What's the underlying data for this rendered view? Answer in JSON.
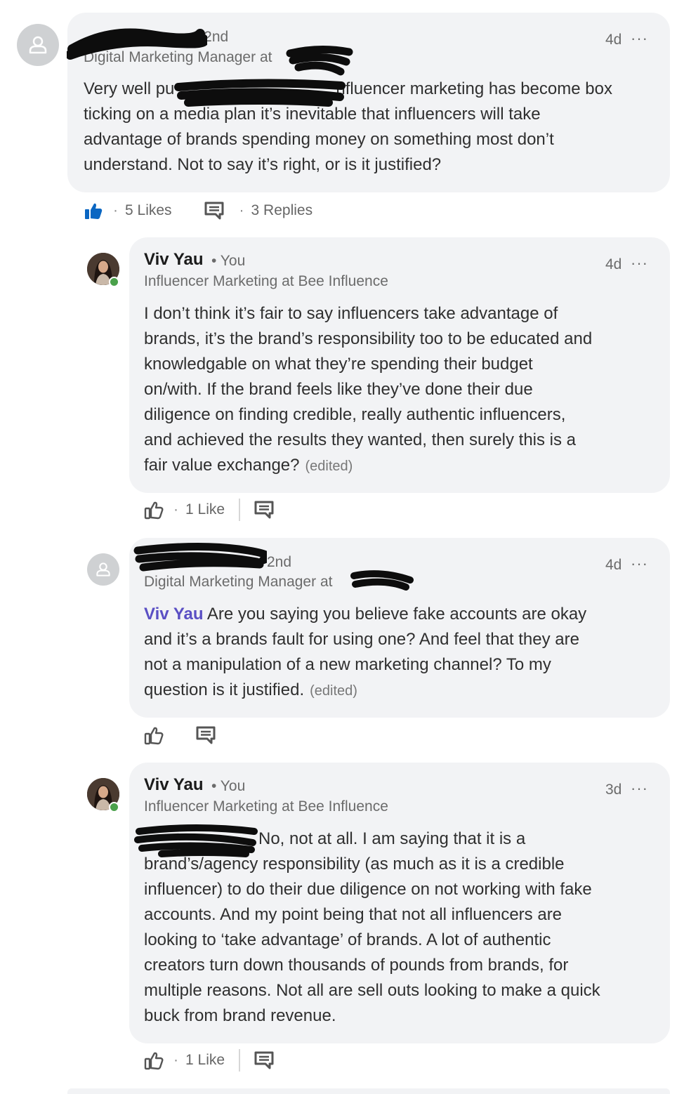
{
  "comments": [
    {
      "author": "",
      "degree": "• 2nd",
      "headline": "Digital Marketing Manager at",
      "time": "4d",
      "more": "···",
      "text": "Very well put. Influencer marketing has become box ticking on a media plan it’s inevitable that influencers will take advantage of brands spending money on something most don’t understand. Not to say it’s right, or is it justified?",
      "text_lines": [
        "Very well pu",
        "nfluencer marketing has become box",
        "ticking on a media plan it’s inevitable that influencers will take",
        "advantage of brands spending money on something most don’t",
        "understand. Not to say it’s right, or is it justified?"
      ],
      "likes": "5 Likes",
      "replies": "3 Replies"
    },
    {
      "author": "Viv Yau",
      "degree": "• You",
      "headline": "Influencer Marketing at Bee Influence",
      "time": "4d",
      "more": "···",
      "text_lines": [
        "I don’t think it’s fair to say influencers take advantage of",
        "brands, it’s the brand’s responsibility too to be educated and",
        "knowledgable on what they’re spending their budget",
        "on/with. If the brand feels like they’ve done their due",
        "diligence on finding credible, really authentic influencers,",
        "and achieved the results they wanted, then surely this is a",
        "fair value exchange?"
      ],
      "edited": "(edited)",
      "likes": "1 Like"
    },
    {
      "author": "",
      "degree": "2nd",
      "headline": "Digital Marketing Manager at",
      "time": "4d",
      "more": "···",
      "mention": "Viv Yau",
      "text_lines": [
        " Are you saying you believe fake accounts are okay",
        "and it’s a brands fault for using one? And feel that they are",
        "not a manipulation of a new marketing channel? To my",
        "question is it justified."
      ],
      "edited": "(edited)"
    },
    {
      "author": "Viv Yau",
      "degree": "• You",
      "headline": "Influencer Marketing at Bee Influence",
      "time": "3d",
      "more": "···",
      "text_lines": [
        "No, not at all. I am saying that it is a",
        "brand’s/agency responsibility (as much as it is a credible",
        "influencer) to do their due diligence on not working with fake",
        "accounts. And my point being that not all influencers are",
        "looking to ‘take advantage’ of brands. A lot of authentic",
        "creators turn down thousands of pounds from brands, for",
        "multiple reasons. Not all are sell outs looking to make a quick",
        "buck from brand revenue."
      ],
      "likes": "1 Like"
    }
  ],
  "icons": {
    "avatar_placeholder": "person-outline-icon",
    "like_filled": "thumbs-up-filled-icon",
    "like_outline": "thumbs-up-outline-icon",
    "reply": "comment-icon"
  },
  "colors": {
    "bubble": "#f2f3f5",
    "like_active": "#0a66c2",
    "mention": "#5a4fc4",
    "presence": "#4aa14b"
  }
}
